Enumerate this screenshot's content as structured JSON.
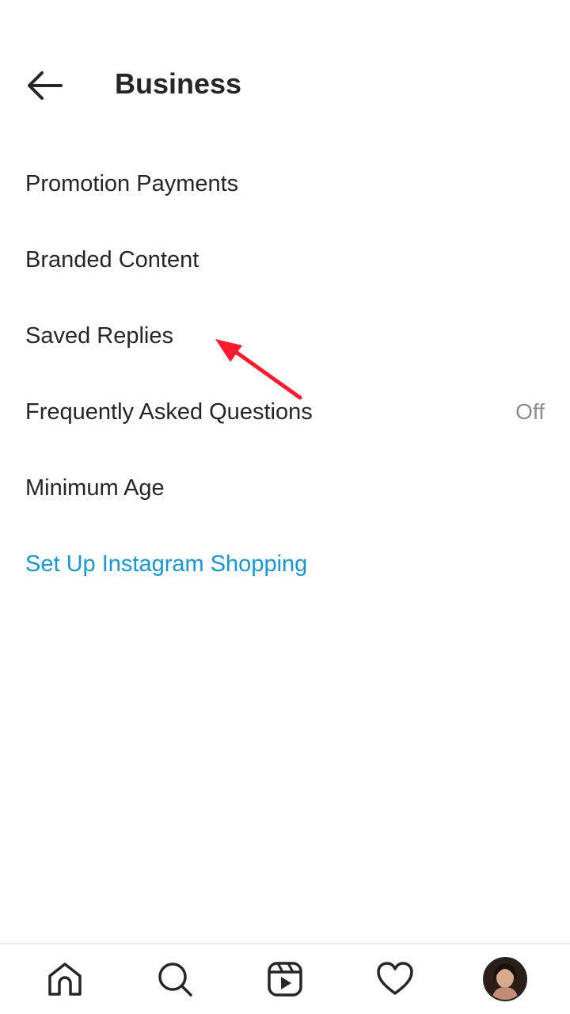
{
  "header": {
    "title": "Business",
    "back_icon": "arrow-left-icon"
  },
  "menu": {
    "items": [
      {
        "label": "Promotion Payments",
        "value": ""
      },
      {
        "label": "Branded Content",
        "value": ""
      },
      {
        "label": "Saved Replies",
        "value": ""
      },
      {
        "label": "Frequently Asked Questions",
        "value": "Off"
      },
      {
        "label": "Minimum Age",
        "value": ""
      },
      {
        "label": "Set Up Instagram Shopping",
        "value": ""
      }
    ]
  },
  "annotation": {
    "color": "#ff1a2e"
  },
  "bottom_nav": {
    "items": [
      {
        "icon": "home-icon"
      },
      {
        "icon": "search-icon"
      },
      {
        "icon": "reels-icon"
      },
      {
        "icon": "heart-icon"
      },
      {
        "icon": "profile-avatar"
      }
    ]
  },
  "colors": {
    "text": "#262626",
    "link": "#1897d6",
    "secondary": "#8e8e8e",
    "divider": "#dbdbdb"
  }
}
